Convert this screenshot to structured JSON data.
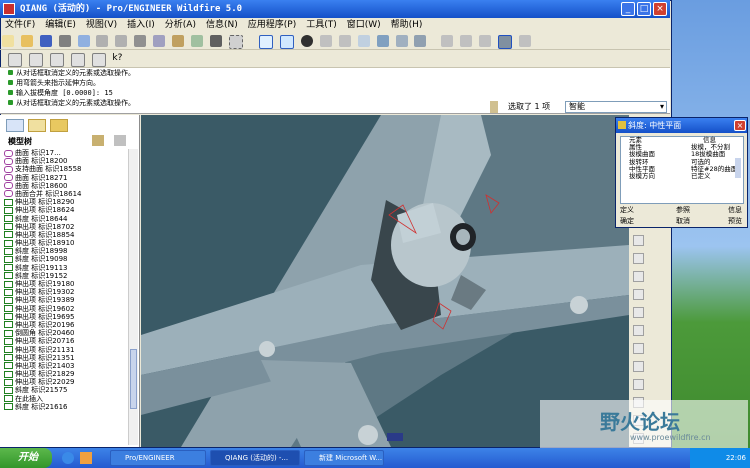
{
  "window": {
    "title": "QIANG (活动的) - Pro/ENGINEER Wildfire 5.0"
  },
  "menu": [
    "文件(F)",
    "编辑(E)",
    "视图(V)",
    "插入(I)",
    "分析(A)",
    "信息(N)",
    "应用程序(P)",
    "工具(T)",
    "窗口(W)",
    "帮助(H)"
  ],
  "messages": [
    "从对话框取消定义的元素或选取操作。",
    "用弯箭头来指示延伸方向。",
    "输入拔模角度 [0.0000]:      15",
    "从对话框取消定义的元素或选取操作。"
  ],
  "filter": {
    "selected_text": "选取了 1 项",
    "dropdown_value": "智能"
  },
  "nav": {
    "header": "模型树",
    "items": [
      "曲面 标识17...",
      "曲面 标识18200",
      "支持曲面 标识18558",
      "曲面 标识18271",
      "曲面 标识18600",
      "曲面合并 标识18614",
      "伸出项 标识18290",
      "伸出项 标识18624",
      "斜度 标识18644",
      "伸出项 标识18702",
      "伸出项 标识18854",
      "伸出项 标识18910",
      "斜度 标识18998",
      "斜度 标识19098",
      "斜度 标识19113",
      "斜度 标识19152",
      "伸出项 标识19180",
      "伸出项 标识19302",
      "伸出项 标识19389",
      "伸出项 标识19602",
      "伸出项 标识19695",
      "伸出项 标识20196",
      "倒圆角 标识20460",
      "伸出项 标识20716",
      "伸出项 标识21131",
      "伸出项 标识21351",
      "伸出项 标识21403",
      "伸出项 标识21829",
      "伸出项 标识22029",
      "斜度 标识21575",
      "在此插入",
      "斜度 标识21616"
    ]
  },
  "dialog": {
    "title": "斜度: 中性平面",
    "col_element": "元素",
    "col_info": "信息",
    "rows": [
      {
        "k": "属性",
        "v": "拔模，不分割"
      },
      {
        "k": "拔模曲面",
        "v": "18拔模曲面"
      },
      {
        "k": "拔转环",
        "v": "可选的"
      },
      {
        "k": "中性平面",
        "v": "特征#28的曲面"
      },
      {
        "k": "拔模方向",
        "v": "已定义"
      }
    ],
    "buttons": {
      "define": "定义",
      "ref": "参照",
      "info": "信息",
      "ok": "确定",
      "cancel": "取消",
      "preview": "预览"
    }
  },
  "taskbar": {
    "start": "开始",
    "tasks": [
      "Pro/ENGINEER",
      "QIANG (活动的) -...",
      "新建 Microsoft W..."
    ],
    "clock": "22:06"
  },
  "watermark": {
    "text": "野火论坛",
    "url": "www.proewildfire.cn"
  }
}
